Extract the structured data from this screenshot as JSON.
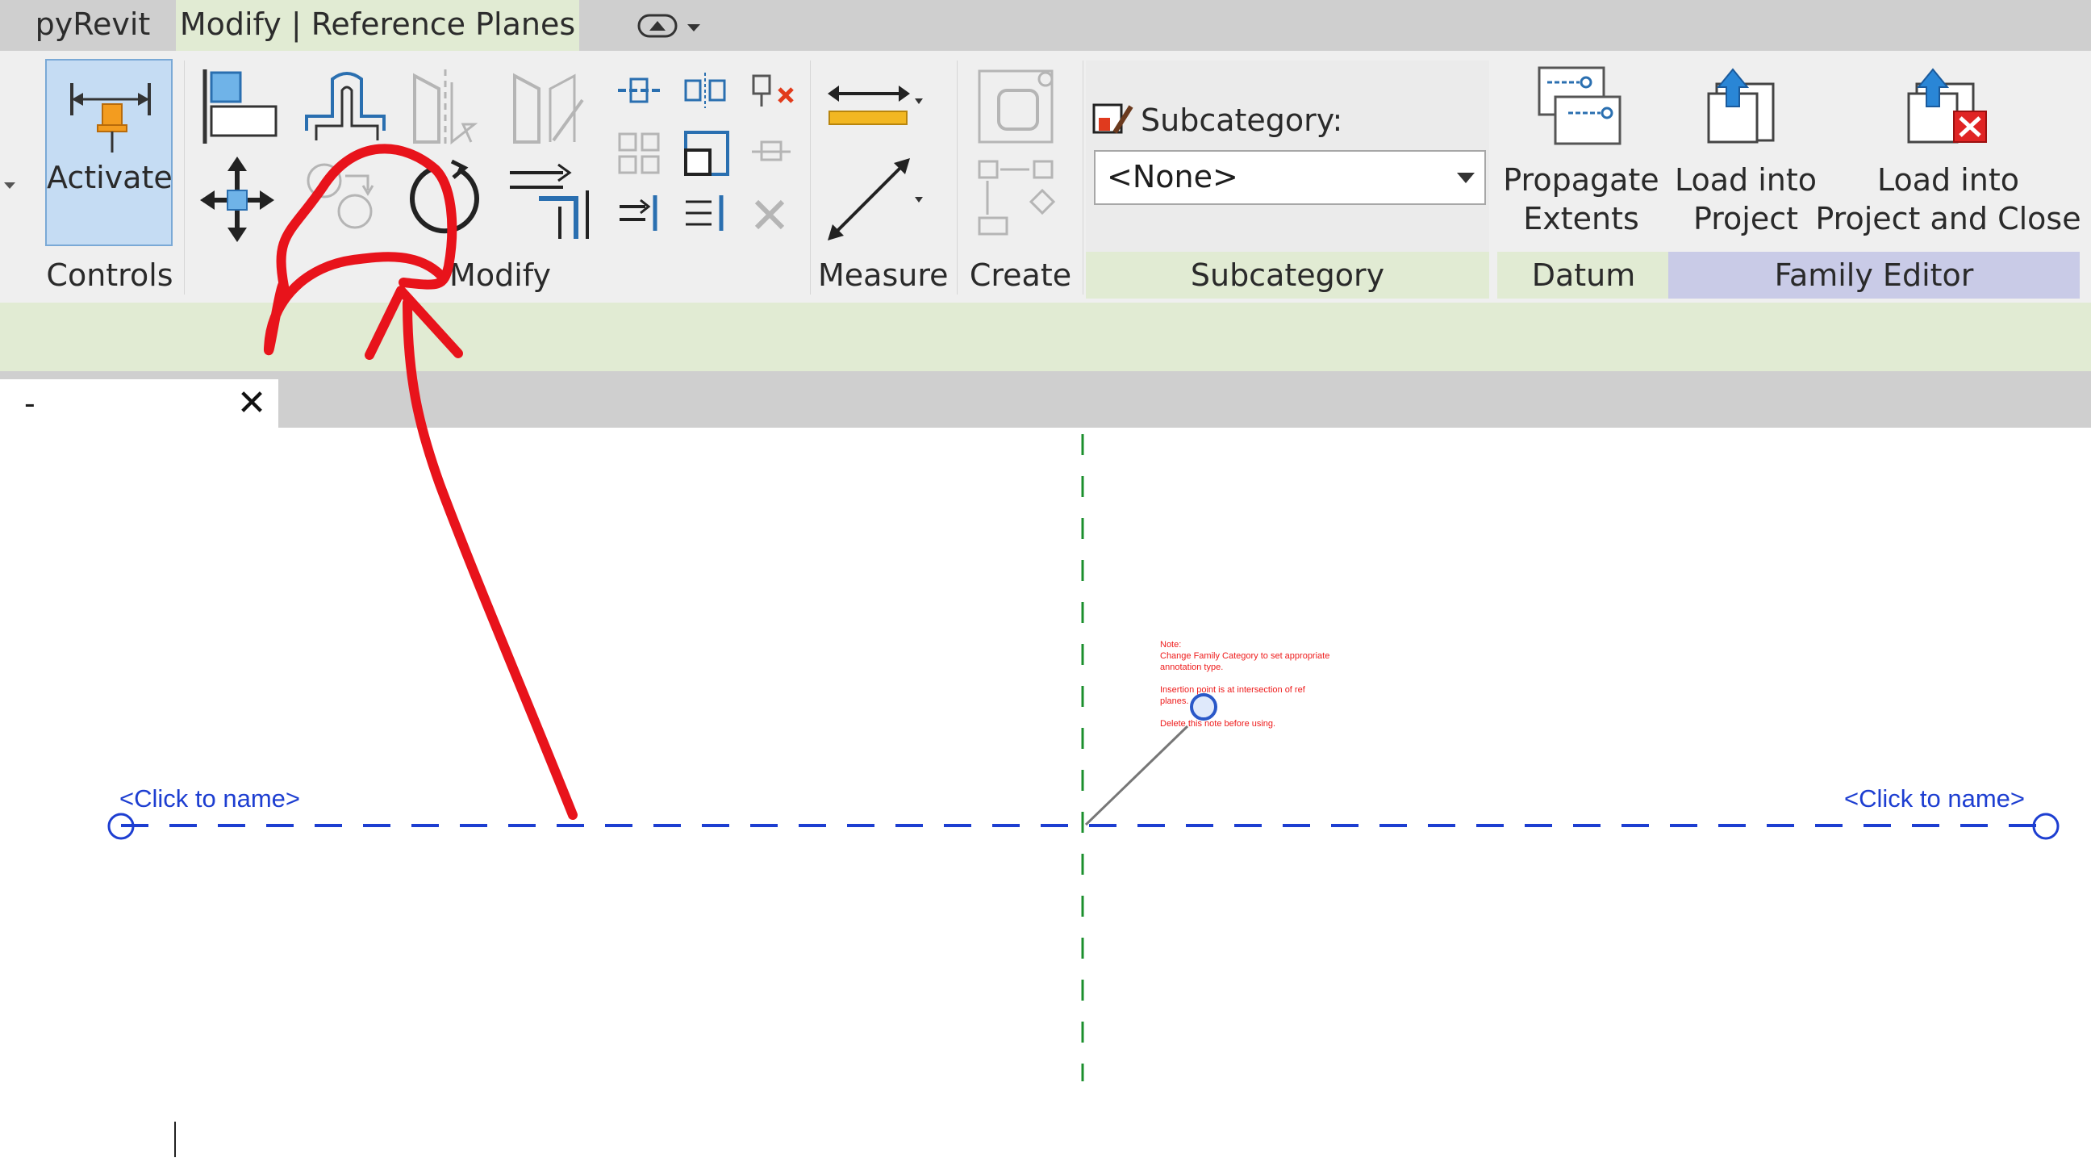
{
  "tabs": [
    {
      "label": "pyRevit",
      "active": false
    },
    {
      "label": "Modify | Reference Planes",
      "active": true
    }
  ],
  "ribbon": {
    "controls": {
      "button_label": "Activate",
      "panel_label": "Controls"
    },
    "modify": {
      "panel_label": "Modify"
    },
    "measure": {
      "panel_label": "Measure"
    },
    "create": {
      "panel_label": "Create"
    },
    "subcategory": {
      "field_label": "Subcategory:",
      "selected_value": "<None>",
      "panel_label": "Subcategory"
    },
    "datum": {
      "button_label_line1": "Propagate",
      "button_label_line2": "Extents",
      "panel_label": "Datum"
    },
    "family_editor": {
      "load_into_project_line1": "Load into",
      "load_into_project_line2": "Project",
      "load_and_close_line1": "Load into",
      "load_and_close_line2": "Project and Close",
      "panel_label": "Family Editor"
    }
  },
  "view_tab": {
    "name": "-",
    "close_symbol": "✕"
  },
  "canvas": {
    "reference_plane_label_left": "<Click to name>",
    "reference_plane_label_right": "<Click to name>",
    "note_lines": [
      "Note:",
      "Change Family Category to set appropriate",
      "annotation type.",
      "",
      "Insertion point is at intersection of ref",
      "planes.",
      "",
      "Delete this note before using."
    ]
  },
  "colors": {
    "accent_red_annotation": "#e8131b",
    "reference_plane_blue": "#1d3ed1",
    "reference_plane_green": "#1b8f2d",
    "note_red": "#ee1b1b",
    "active_tab_bg": "#e1ebd3",
    "family_editor_panel_bg": "#c9cbe7"
  }
}
